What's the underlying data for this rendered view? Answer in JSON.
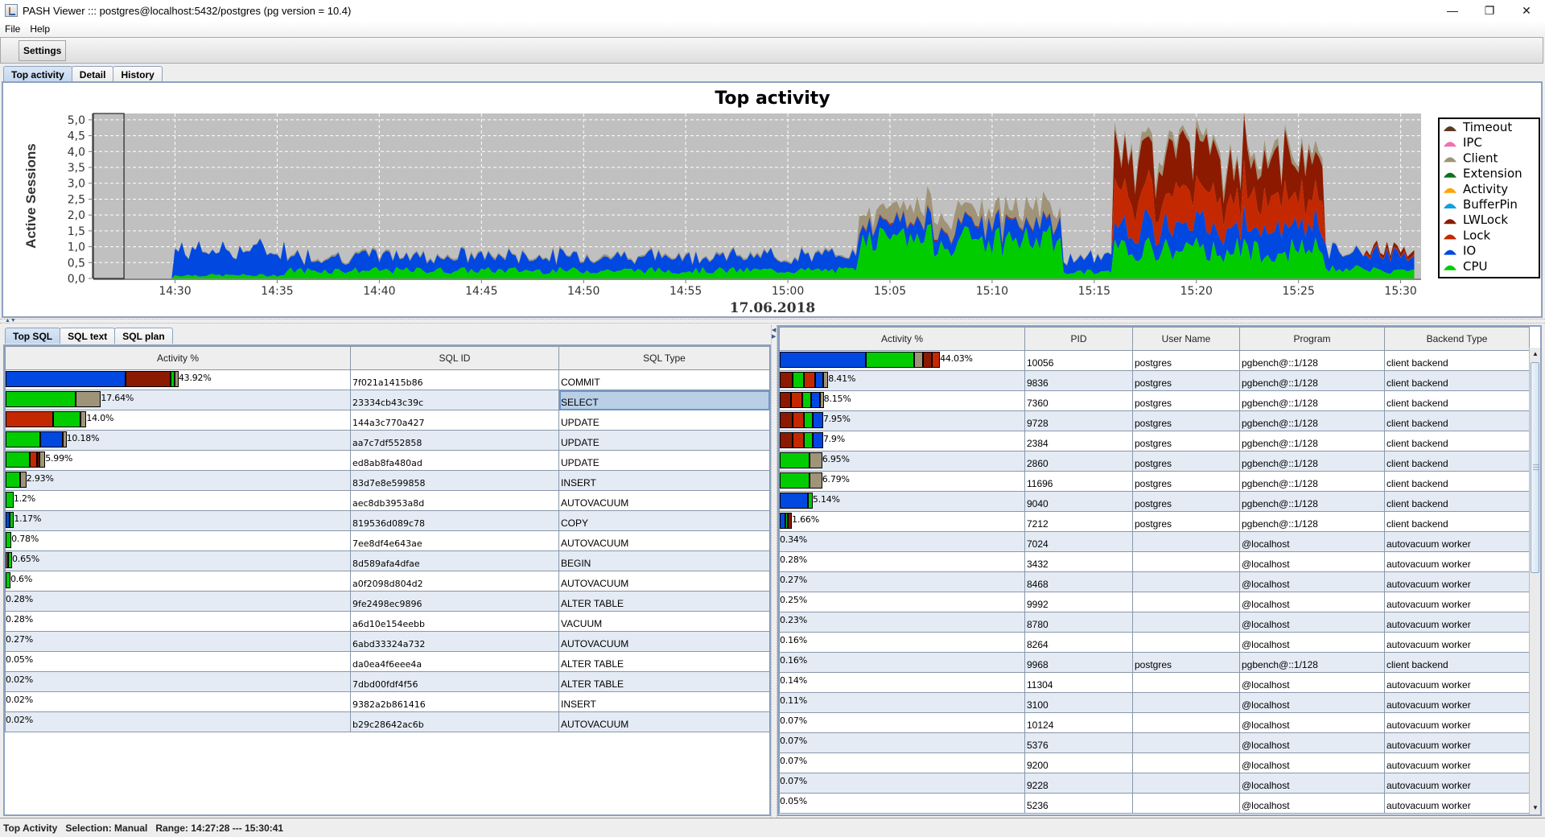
{
  "window": {
    "title": "PASH Viewer ::: postgres@localhost:5432/postgres (pg version = 10.4)",
    "controls": {
      "minimize": "—",
      "maximize": "❐",
      "close": "✕"
    }
  },
  "menu": [
    {
      "label": "File",
      "mnemonic": "F"
    },
    {
      "label": "Help",
      "mnemonic": "H"
    }
  ],
  "toolbar": {
    "settings_label": "Settings"
  },
  "main_tabs": [
    {
      "label": "Top activity",
      "active": true
    },
    {
      "label": "Detail",
      "active": false
    },
    {
      "label": "History",
      "active": false
    }
  ],
  "colors": {
    "Timeout": "#5a3a1e",
    "IPC": "#f070b0",
    "Client": "#a09478",
    "Extension": "#107020",
    "Activity": "#ffa400",
    "BufferPin": "#10a0e0",
    "LWLock": "#8b1a00",
    "Lock": "#c42800",
    "IO": "#0048e0",
    "CPU": "#00cc00",
    "plot_bg": "#c0c0c0",
    "selection_frame": "#000000"
  },
  "chart_data": {
    "type": "area",
    "stacked": true,
    "title": "Top activity",
    "ylabel": "Active Sessions",
    "xlabel": "17.06.2018",
    "ylim": [
      0,
      5.2
    ],
    "yticks": [
      "0,0",
      "0,5",
      "1,0",
      "1,5",
      "2,0",
      "2,5",
      "3,0",
      "3,5",
      "4,0",
      "4,5",
      "5,0"
    ],
    "ytick_values": [
      0,
      0.5,
      1,
      1.5,
      2,
      2.5,
      3,
      3.5,
      4,
      4.5,
      5
    ],
    "x_range": [
      "14:26:00",
      "15:31:00"
    ],
    "xticks": [
      "14:30",
      "14:35",
      "14:40",
      "14:45",
      "14:50",
      "14:55",
      "15:00",
      "15:05",
      "15:10",
      "15:15",
      "15:20",
      "15:25",
      "15:30"
    ],
    "grid": true,
    "legend_position": "right",
    "legend": [
      "Timeout",
      "IPC",
      "Client",
      "Extension",
      "Activity",
      "BufferPin",
      "LWLock",
      "Lock",
      "IO",
      "CPU"
    ],
    "selection": [
      "14:26:00",
      "14:27:30"
    ],
    "series_order_bottom_to_top": [
      "CPU",
      "IO",
      "Lock",
      "LWLock",
      "Client"
    ],
    "segments": [
      {
        "from": "14:26:00",
        "to": "14:30:00",
        "CPU": 0.0,
        "IO": 0.0,
        "Lock": 0,
        "LWLock": 0,
        "Client": 0.0
      },
      {
        "from": "14:30:00",
        "to": "14:35:30",
        "CPU": 0.1,
        "IO": 0.8,
        "Lock": 0,
        "LWLock": 0,
        "Client": 0.02
      },
      {
        "from": "14:35:30",
        "to": "15:03:30",
        "CPU": 0.25,
        "IO": 0.45,
        "Lock": 0,
        "LWLock": 0,
        "Client": 0.05
      },
      {
        "from": "15:03:30",
        "to": "15:13:30",
        "CPU": 1.2,
        "IO": 0.5,
        "Lock": 0.02,
        "LWLock": 0.02,
        "Client": 0.45
      },
      {
        "from": "15:13:30",
        "to": "15:16:00",
        "CPU": 0.2,
        "IO": 0.45,
        "Lock": 0,
        "LWLock": 0,
        "Client": 0.03
      },
      {
        "from": "15:16:00",
        "to": "15:26:15",
        "CPU": 0.9,
        "IO": 0.75,
        "Lock": 1.0,
        "LWLock": 1.25,
        "Client": 0.25
      },
      {
        "from": "15:26:15",
        "to": "15:28:15",
        "CPU": 0.3,
        "IO": 0.6,
        "Lock": 0,
        "LWLock": 0,
        "Client": 0.03
      },
      {
        "from": "15:28:15",
        "to": "15:30:41",
        "CPU": 0.25,
        "IO": 0.55,
        "Lock": 0.05,
        "LWLock": 0.12,
        "Client": 0.02
      }
    ],
    "peak": {
      "time": "15:20:30",
      "total": 4.9
    }
  },
  "lower_tabs": [
    {
      "label": "Top SQL",
      "active": true
    },
    {
      "label": "SQL text",
      "active": false
    },
    {
      "label": "SQL plan",
      "active": false
    }
  ],
  "top_sql": {
    "columns": [
      "Activity %",
      "SQL ID",
      "SQL Type"
    ],
    "rows": [
      {
        "pct": "43.92%",
        "value": 43.92,
        "segments": [
          [
            "IO",
            22.5
          ],
          [
            "LWLock",
            8.5
          ],
          [
            "CPU",
            0.8
          ],
          [
            "Client",
            0.4
          ]
        ],
        "sql_id": "7f021a1415b86",
        "type": "COMMIT"
      },
      {
        "pct": "17.64%",
        "value": 17.64,
        "segments": [
          [
            "CPU",
            13.2
          ],
          [
            "Client",
            4.44
          ]
        ],
        "sql_id": "23334cb43c39c",
        "type": "SELECT",
        "selected": true
      },
      {
        "pct": "14.0%",
        "value": 14.0,
        "segments": [
          [
            "Lock",
            9.0
          ],
          [
            "CPU",
            5.1
          ],
          [
            "Client",
            0.8
          ]
        ],
        "sql_id": "144a3c770a427",
        "type": "UPDATE"
      },
      {
        "pct": "10.18%",
        "value": 10.18,
        "segments": [
          [
            "CPU",
            6.5
          ],
          [
            "IO",
            4.2
          ],
          [
            "Client",
            0.3
          ]
        ],
        "sql_id": "aa7c7df552858",
        "type": "UPDATE"
      },
      {
        "pct": "5.99%",
        "value": 5.99,
        "segments": [
          [
            "CPU",
            4.6
          ],
          [
            "Lock",
            1.3
          ],
          [
            "LWLock",
            0.2
          ],
          [
            "Client",
            0.8
          ]
        ],
        "sql_id": "ed8ab8fa480ad",
        "type": "UPDATE"
      },
      {
        "pct": "2.93%",
        "value": 2.93,
        "segments": [
          [
            "CPU",
            2.7
          ],
          [
            "Client",
            0.9
          ]
        ],
        "sql_id": "83d7e8e599858",
        "type": "INSERT"
      },
      {
        "pct": "1.2%",
        "value": 1.2,
        "segments": [
          [
            "CPU",
            1.2
          ]
        ],
        "sql_id": "aec8db3953a8d",
        "type": "AUTOVACUUM"
      },
      {
        "pct": "1.17%",
        "value": 1.17,
        "segments": [
          [
            "IO",
            0.8
          ],
          [
            "CPU",
            0.37
          ]
        ],
        "sql_id": "819536d089c78",
        "type": "COPY"
      },
      {
        "pct": "0.78%",
        "value": 0.78,
        "segments": [
          [
            "CPU",
            0.78
          ]
        ],
        "sql_id": "7ee8df4e643ae",
        "type": "AUTOVACUUM"
      },
      {
        "pct": "0.65%",
        "value": 0.65,
        "segments": [
          [
            "Client",
            0.35
          ],
          [
            "CPU",
            0.3
          ]
        ],
        "sql_id": "8d589afa4dfae",
        "type": "BEGIN"
      },
      {
        "pct": "0.6%",
        "value": 0.6,
        "segments": [
          [
            "CPU",
            0.6
          ]
        ],
        "sql_id": "a0f2098d804d2",
        "type": "AUTOVACUUM"
      },
      {
        "pct": "0.28%",
        "value": 0.28,
        "segments": [],
        "sql_id": "9fe2498ec9896",
        "type": "ALTER TABLE"
      },
      {
        "pct": "0.28%",
        "value": 0.28,
        "segments": [],
        "sql_id": "a6d10e154eebb",
        "type": "VACUUM"
      },
      {
        "pct": "0.27%",
        "value": 0.27,
        "segments": [],
        "sql_id": "6abd33324a732",
        "type": "AUTOVACUUM"
      },
      {
        "pct": "0.05%",
        "value": 0.05,
        "segments": [],
        "sql_id": "da0ea4f6eee4a",
        "type": "ALTER TABLE"
      },
      {
        "pct": "0.02%",
        "value": 0.02,
        "segments": [],
        "sql_id": "7dbd00fdf4f56",
        "type": "ALTER TABLE"
      },
      {
        "pct": "0.02%",
        "value": 0.02,
        "segments": [],
        "sql_id": "9382a2b861416",
        "type": "INSERT"
      },
      {
        "pct": "0.02%",
        "value": 0.02,
        "segments": [],
        "sql_id": "b29c28642ac6b",
        "type": "AUTOVACUUM"
      }
    ]
  },
  "top_sessions": {
    "columns": [
      "Activity %",
      "PID",
      "User Name",
      "Program",
      "Backend Type"
    ],
    "rows": [
      {
        "pct": "44.03%",
        "value": 44.03,
        "segments": [
          [
            "IO",
            19.8
          ],
          [
            "CPU",
            11.2
          ],
          [
            "Client",
            2.0
          ],
          [
            "LWLock",
            2.0
          ],
          [
            "Lock",
            1.5
          ]
        ],
        "pid": "10056",
        "user": "postgres",
        "program": "pgbench@::1/128",
        "backend": "client backend"
      },
      {
        "pct": "8.41%",
        "value": 8.41,
        "segments": [
          [
            "LWLock",
            3.0
          ],
          [
            "CPU",
            2.6
          ],
          [
            "Lock",
            2.6
          ],
          [
            "IO",
            1.8
          ],
          [
            "Client",
            0.8
          ]
        ],
        "pid": "9836",
        "user": "postgres",
        "program": "pgbench@::1/128",
        "backend": "client backend"
      },
      {
        "pct": "8.15%",
        "value": 8.15,
        "segments": [
          [
            "LWLock",
            2.6
          ],
          [
            "Lock",
            2.6
          ],
          [
            "CPU",
            2.0
          ],
          [
            "IO",
            2.0
          ],
          [
            "Client",
            0.2
          ]
        ],
        "pid": "7360",
        "user": "postgres",
        "program": "pgbench@::1/128",
        "backend": "client backend"
      },
      {
        "pct": "7.95%",
        "value": 7.95,
        "segments": [
          [
            "LWLock",
            3.0
          ],
          [
            "Lock",
            2.6
          ],
          [
            "CPU",
            2.0
          ],
          [
            "IO",
            2.0
          ]
        ],
        "pid": "9728",
        "user": "postgres",
        "program": "pgbench@::1/128",
        "backend": "client backend"
      },
      {
        "pct": "7.9%",
        "value": 7.9,
        "segments": [
          [
            "LWLock",
            3.0
          ],
          [
            "Lock",
            2.6
          ],
          [
            "CPU",
            2.0
          ],
          [
            "IO",
            2.0
          ]
        ],
        "pid": "2384",
        "user": "postgres",
        "program": "pgbench@::1/128",
        "backend": "client backend"
      },
      {
        "pct": "6.95%",
        "value": 6.95,
        "segments": [
          [
            "CPU",
            6.9
          ],
          [
            "Client",
            2.5
          ]
        ],
        "pid": "2860",
        "user": "postgres",
        "program": "pgbench@::1/128",
        "backend": "client backend"
      },
      {
        "pct": "6.79%",
        "value": 6.79,
        "segments": [
          [
            "CPU",
            6.9
          ],
          [
            "Client",
            2.5
          ]
        ],
        "pid": "11696",
        "user": "postgres",
        "program": "pgbench@::1/128",
        "backend": "client backend"
      },
      {
        "pct": "5.14%",
        "value": 5.14,
        "segments": [
          [
            "IO",
            6.4
          ],
          [
            "CPU",
            0.8
          ]
        ],
        "pid": "9040",
        "user": "postgres",
        "program": "pgbench@::1/128",
        "backend": "client backend"
      },
      {
        "pct": "1.66%",
        "value": 1.66,
        "segments": [
          [
            "IO",
            1.3
          ],
          [
            "CPU",
            0.2
          ],
          [
            "LWLock",
            0.2
          ]
        ],
        "pid": "7212",
        "user": "postgres",
        "program": "pgbench@::1/128",
        "backend": "client backend"
      },
      {
        "pct": "0.34%",
        "value": 0.34,
        "segments": [],
        "pid": "7024",
        "user": "",
        "program": "@localhost",
        "backend": "autovacuum worker"
      },
      {
        "pct": "0.28%",
        "value": 0.28,
        "segments": [],
        "pid": "3432",
        "user": "",
        "program": "@localhost",
        "backend": "autovacuum worker"
      },
      {
        "pct": "0.27%",
        "value": 0.27,
        "segments": [],
        "pid": "8468",
        "user": "",
        "program": "@localhost",
        "backend": "autovacuum worker"
      },
      {
        "pct": "0.25%",
        "value": 0.25,
        "segments": [],
        "pid": "9992",
        "user": "",
        "program": "@localhost",
        "backend": "autovacuum worker"
      },
      {
        "pct": "0.23%",
        "value": 0.23,
        "segments": [],
        "pid": "8780",
        "user": "",
        "program": "@localhost",
        "backend": "autovacuum worker"
      },
      {
        "pct": "0.16%",
        "value": 0.16,
        "segments": [],
        "pid": "8264",
        "user": "",
        "program": "@localhost",
        "backend": "autovacuum worker"
      },
      {
        "pct": "0.16%",
        "value": 0.16,
        "segments": [],
        "pid": "9968",
        "user": "postgres",
        "program": "pgbench@::1/128",
        "backend": "client backend"
      },
      {
        "pct": "0.14%",
        "value": 0.14,
        "segments": [],
        "pid": "11304",
        "user": "",
        "program": "@localhost",
        "backend": "autovacuum worker"
      },
      {
        "pct": "0.11%",
        "value": 0.11,
        "segments": [],
        "pid": "3100",
        "user": "",
        "program": "@localhost",
        "backend": "autovacuum worker"
      },
      {
        "pct": "0.07%",
        "value": 0.07,
        "segments": [],
        "pid": "10124",
        "user": "",
        "program": "@localhost",
        "backend": "autovacuum worker"
      },
      {
        "pct": "0.07%",
        "value": 0.07,
        "segments": [],
        "pid": "5376",
        "user": "",
        "program": "@localhost",
        "backend": "autovacuum worker"
      },
      {
        "pct": "0.07%",
        "value": 0.07,
        "segments": [],
        "pid": "9200",
        "user": "",
        "program": "@localhost",
        "backend": "autovacuum worker"
      },
      {
        "pct": "0.07%",
        "value": 0.07,
        "segments": [],
        "pid": "9228",
        "user": "",
        "program": "@localhost",
        "backend": "autovacuum worker"
      },
      {
        "pct": "0.05%",
        "value": 0.05,
        "segments": [],
        "pid": "5236",
        "user": "",
        "program": "@localhost",
        "backend": "autovacuum worker"
      }
    ]
  },
  "status_bar": {
    "mode": "Top Activity",
    "selection": "Selection: Manual",
    "range": "Range: 14:27:28 --- 15:30:41"
  }
}
